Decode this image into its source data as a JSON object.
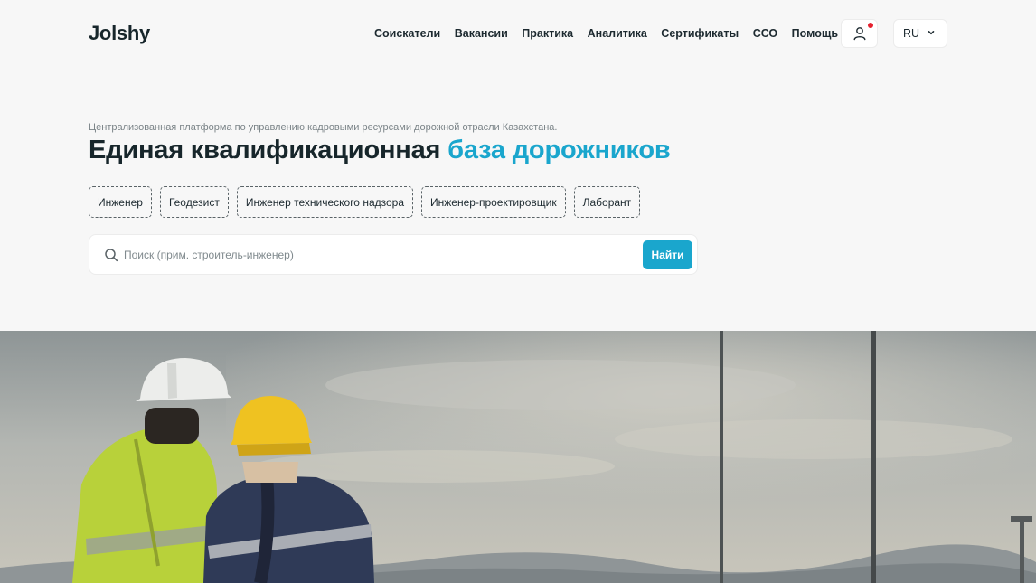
{
  "header": {
    "logo": "Jolshy",
    "nav": [
      "Соискатели",
      "Вакансии",
      "Практика",
      "Аналитика",
      "Сертификаты",
      "ССО",
      "Помощь"
    ],
    "language": "RU"
  },
  "hero": {
    "tagline": "Централизованная платформа по управлению кадровыми ресурсами дорожной отрасли Казахстана.",
    "title_main": "Единая квалификационная",
    "title_accent": "база дорожников",
    "chips": [
      "Инженер",
      "Геодезист",
      "Инженер технического надзора",
      "Инженер-проектировщик",
      "Лаборант"
    ]
  },
  "search": {
    "placeholder": "Поиск (прим. строитель-инженер)",
    "value": "",
    "button_label": "Найти"
  },
  "colors": {
    "accent": "#1aa6cd",
    "notification_dot": "#e5202e",
    "background": "#f7f7f7"
  },
  "icons": [
    "user-icon",
    "chevron-down-icon",
    "search-icon"
  ]
}
